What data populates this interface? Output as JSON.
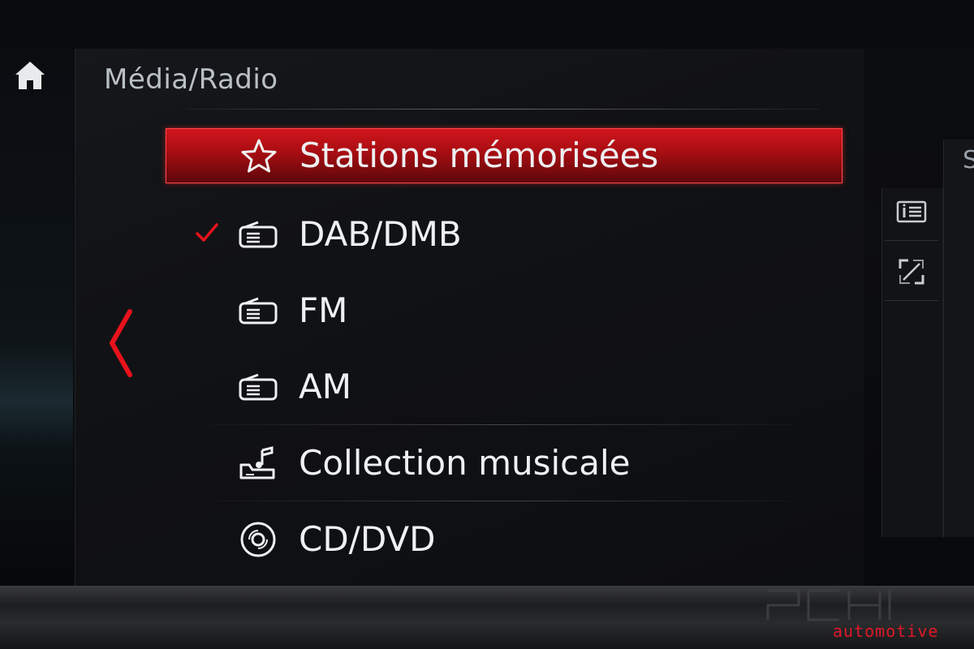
{
  "header": {
    "title": "Média/Radio"
  },
  "nav": {
    "home_icon": "home-icon",
    "back_icon": "chevron-left-icon"
  },
  "menu": {
    "items": [
      {
        "label": "Stations mémorisées",
        "icon": "star-icon",
        "selected": true,
        "checked": false
      },
      {
        "label": "DAB/DMB",
        "icon": "radio-icon",
        "selected": false,
        "checked": true
      },
      {
        "label": "FM",
        "icon": "radio-icon",
        "selected": false,
        "checked": false
      },
      {
        "label": "AM",
        "icon": "radio-icon",
        "selected": false,
        "checked": false
      },
      {
        "label": "Collection musicale",
        "icon": "music-collection-icon",
        "selected": false,
        "checked": false
      },
      {
        "label": "CD/DVD",
        "icon": "disc-icon",
        "selected": false,
        "checked": false
      }
    ]
  },
  "side": {
    "buttons": [
      {
        "icon": "info-list-icon"
      },
      {
        "icon": "expand-icon"
      }
    ],
    "partial_letter": "S"
  },
  "watermark": {
    "text": "automotive"
  },
  "colors": {
    "accent": "#d3151c",
    "text": "#eef0f2",
    "title": "#b9c0c6"
  }
}
